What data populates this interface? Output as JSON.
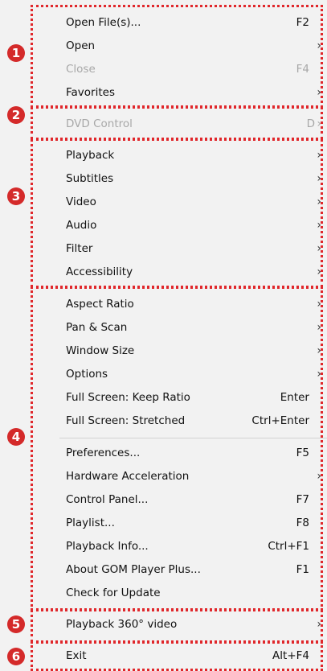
{
  "menu": {
    "items": [
      {
        "label": "Open File(s)...",
        "shortcut": "F2",
        "arrow": ""
      },
      {
        "label": "Open",
        "shortcut": "",
        "arrow": "›"
      },
      {
        "label": "Close",
        "shortcut": "F4",
        "arrow": ""
      },
      {
        "label": "Favorites",
        "shortcut": "",
        "arrow": "›"
      },
      {
        "label": "DVD Control",
        "shortcut": "D",
        "arrow": "›"
      },
      {
        "label": "Playback",
        "shortcut": "",
        "arrow": "›"
      },
      {
        "label": "Subtitles",
        "shortcut": "",
        "arrow": "›"
      },
      {
        "label": "Video",
        "shortcut": "",
        "arrow": "›"
      },
      {
        "label": "Audio",
        "shortcut": "",
        "arrow": "›"
      },
      {
        "label": "Filter",
        "shortcut": "",
        "arrow": "›"
      },
      {
        "label": "Accessibility",
        "shortcut": "",
        "arrow": "›"
      },
      {
        "label": "Aspect Ratio",
        "shortcut": "",
        "arrow": "›"
      },
      {
        "label": "Pan & Scan",
        "shortcut": "",
        "arrow": "›"
      },
      {
        "label": "Window Size",
        "shortcut": "",
        "arrow": "›"
      },
      {
        "label": "Options",
        "shortcut": "",
        "arrow": "›"
      },
      {
        "label": "Full Screen: Keep Ratio",
        "shortcut": "Enter",
        "arrow": ""
      },
      {
        "label": "Full Screen: Stretched",
        "shortcut": "Ctrl+Enter",
        "arrow": ""
      },
      {
        "label": "Preferences...",
        "shortcut": "F5",
        "arrow": ""
      },
      {
        "label": "Hardware Acceleration",
        "shortcut": "",
        "arrow": "›"
      },
      {
        "label": "Control Panel...",
        "shortcut": "F7",
        "arrow": ""
      },
      {
        "label": "Playlist...",
        "shortcut": "F8",
        "arrow": ""
      },
      {
        "label": "Playback Info...",
        "shortcut": "Ctrl+F1",
        "arrow": ""
      },
      {
        "label": "About GOM Player Plus...",
        "shortcut": "F1",
        "arrow": ""
      },
      {
        "label": "Check for Update",
        "shortcut": "",
        "arrow": ""
      },
      {
        "label": "Playback 360° video",
        "shortcut": "",
        "arrow": "›"
      },
      {
        "label": "Exit",
        "shortcut": "Alt+F4",
        "arrow": ""
      }
    ]
  },
  "annotations": {
    "badges": [
      "1",
      "2",
      "3",
      "4",
      "5",
      "6"
    ],
    "box_color": "#e0272b",
    "badge_color": "#d42a2a"
  }
}
